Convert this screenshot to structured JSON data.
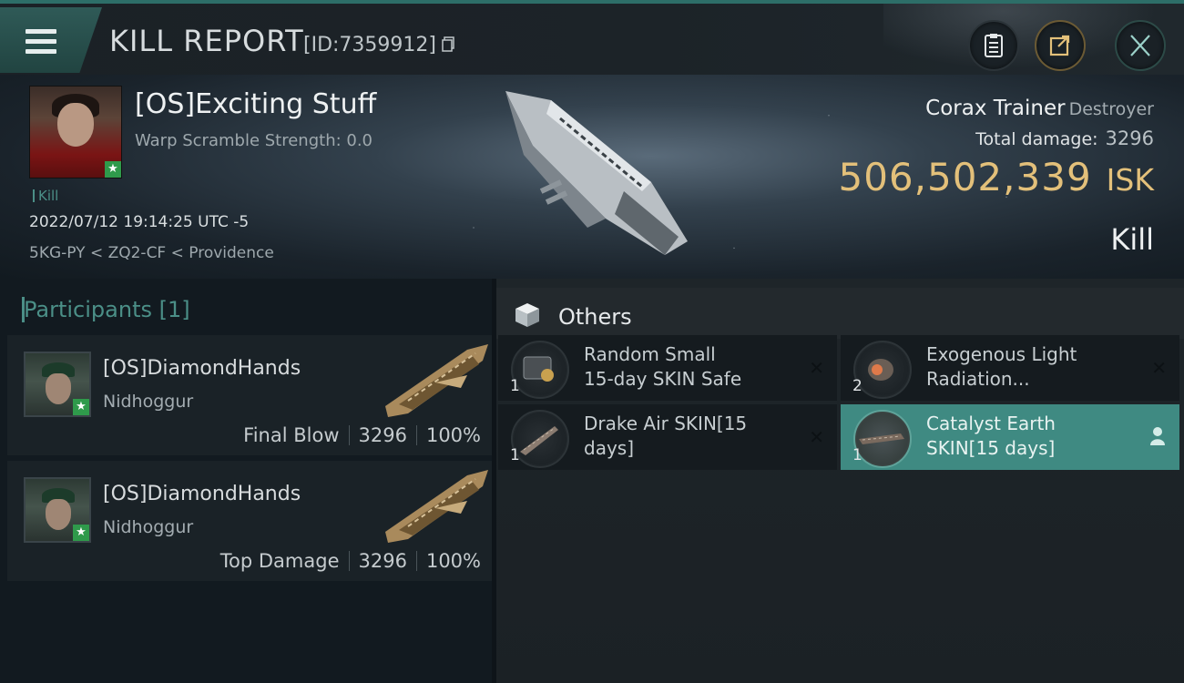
{
  "header": {
    "title": "KILL REPORT",
    "id_text": "[ID:7359912]"
  },
  "victim": {
    "name": "[OS]Exciting Stuff",
    "warp_scramble": "Warp Scramble Strength: 0.0",
    "tag": "Kill",
    "datetime": "2022/07/12 19:14:25 UTC -5",
    "location": "5KG-PY < ZQ2-CF < Providence"
  },
  "ship": {
    "name": "Corax Trainer",
    "class": "Destroyer",
    "total_damage_label": "Total damage:",
    "total_damage": "3296",
    "isk_value": "506,502,339",
    "isk_unit": "ISK",
    "report_type": "Kill"
  },
  "participants": {
    "title": "Participants [1]",
    "rows": [
      {
        "name": "[OS]DiamondHands",
        "ship": "Nidhoggur",
        "role": "Final Blow",
        "damage": "3296",
        "percent": "100%"
      },
      {
        "name": "[OS]DiamondHands",
        "ship": "Nidhoggur",
        "role": "Top Damage",
        "damage": "3296",
        "percent": "100%"
      }
    ]
  },
  "others": {
    "title": "Others",
    "items": [
      {
        "qty": "1",
        "name_line1": "Random Small",
        "name_line2": "15-day SKIN Safe",
        "status": "destroyed"
      },
      {
        "qty": "2",
        "name_line1": "Exogenous Light",
        "name_line2": "Radiation...",
        "status": "destroyed"
      },
      {
        "qty": "1",
        "name_line1": "Drake Air SKIN[15",
        "name_line2": "days]",
        "status": "destroyed"
      },
      {
        "qty": "1",
        "name_line1": "Catalyst Earth",
        "name_line2": "SKIN[15 days]",
        "status": "dropped"
      }
    ]
  },
  "icons": {
    "menu": "hamburger-menu-icon",
    "copy": "copy-icon",
    "clipboard": "clipboard-icon",
    "share": "share-icon",
    "close": "close-icon",
    "cube": "cube-icon",
    "destroyed": "x-icon",
    "dropped": "person-icon"
  },
  "colors": {
    "accent": "#4b8f87",
    "isk": "#e3c07a",
    "highlight_item": "#3f8a82",
    "corp_badge": "#2f9a4b"
  }
}
